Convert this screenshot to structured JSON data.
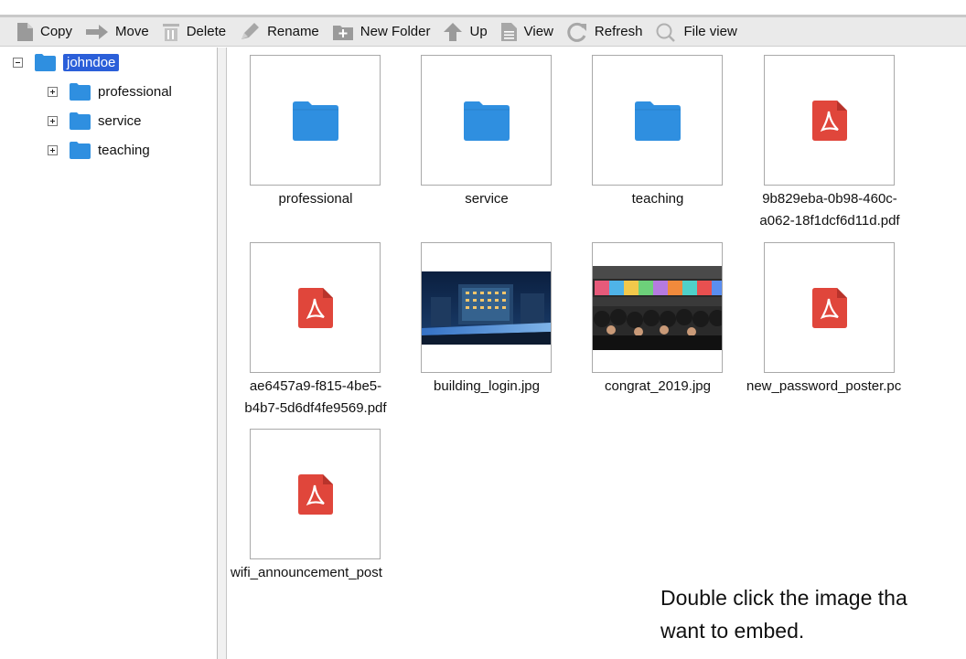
{
  "toolbar": {
    "buttons": [
      {
        "label": "Copy",
        "icon": "copy-icon"
      },
      {
        "label": "Move",
        "icon": "move-arrow-icon"
      },
      {
        "label": "Delete",
        "icon": "trash-icon"
      },
      {
        "label": "Rename",
        "icon": "pencil-icon"
      },
      {
        "label": "New Folder",
        "icon": "new-folder-icon"
      },
      {
        "label": "Up",
        "icon": "up-arrow-icon"
      },
      {
        "label": "View",
        "icon": "document-icon"
      },
      {
        "label": "Refresh",
        "icon": "refresh-icon"
      },
      {
        "label": "File view",
        "icon": "search-icon"
      }
    ]
  },
  "tree": {
    "root": "johndoe",
    "children": [
      "professional",
      "service",
      "teaching"
    ]
  },
  "files": [
    {
      "name": "professional",
      "type": "folder"
    },
    {
      "name": "service",
      "type": "folder"
    },
    {
      "name": "teaching",
      "type": "folder"
    },
    {
      "name_line1": "9b829eba-0b98-460c-",
      "name_line2": "a062-18f1dcf6d11d.pdf",
      "type": "pdf"
    },
    {
      "name_line1": "ae6457a9-f815-4be5-",
      "name_line2": "b4b7-5d6df4fe9569.pdf",
      "type": "pdf"
    },
    {
      "name": "building_login.jpg",
      "type": "image"
    },
    {
      "name": "congrat_2019.jpg",
      "type": "image"
    },
    {
      "name": "new_password_poster.pc",
      "type": "pdf"
    },
    {
      "name": "wifi_announcement_post",
      "type": "pdf"
    }
  ],
  "hint": {
    "line1": "Double click the image tha",
    "line2": "want to embed."
  },
  "colors": {
    "folder": "#2f8fe0",
    "pdf": "#e0463b",
    "selection": "#2b5fd9"
  }
}
